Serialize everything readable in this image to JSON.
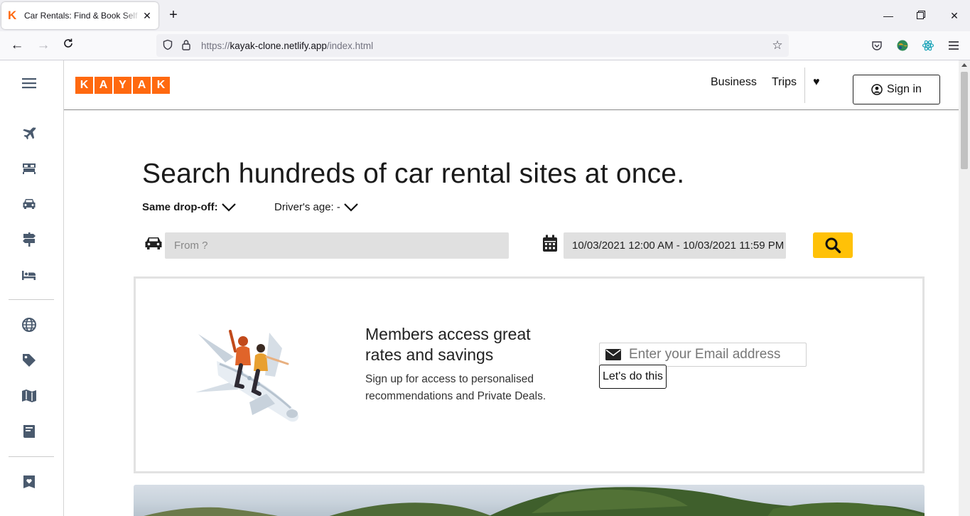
{
  "browser": {
    "tab": {
      "title": "Car Rentals: Find & Book Self Drive Car Rentals"
    },
    "url": {
      "scheme": "https://",
      "host": "kayak-clone.netlify.app",
      "path": "/index.html"
    }
  },
  "site": {
    "logo_letters": [
      "K",
      "A",
      "Y",
      "A",
      "K"
    ],
    "brand_color": "#ff690f",
    "nav": {
      "business": "Business",
      "trips": "Trips",
      "sign_in": "Sign in"
    }
  },
  "sidebar": {
    "items": [
      {
        "name": "flights",
        "icon": "plane-icon"
      },
      {
        "name": "stays",
        "icon": "bed-icon"
      },
      {
        "name": "cars",
        "icon": "car-icon"
      },
      {
        "name": "packages",
        "icon": "signpost-icon"
      },
      {
        "name": "hotels",
        "icon": "hotel-bed-icon"
      },
      {
        "name": "explore",
        "icon": "globe-icon"
      },
      {
        "name": "deals",
        "icon": "tag-icon"
      },
      {
        "name": "guides",
        "icon": "map-icon"
      },
      {
        "name": "blog",
        "icon": "book-icon"
      },
      {
        "name": "saved",
        "icon": "heart-card-icon"
      }
    ]
  },
  "search": {
    "headline": "Search hundreds of car rental sites at once.",
    "same_dropoff": "Same drop-off:",
    "drivers_age": "Driver's age: -",
    "from_placeholder": "From ?",
    "dates_value": "10/03/2021 12:00 AM - 10/03/2021 11:59 PM",
    "button_color": "#ffc107"
  },
  "promo": {
    "title": "Members access great rates and savings",
    "text": "Sign up for access to personalised recommendations and Private Deals.",
    "email_placeholder": "Enter your Email address",
    "cta": "Let's do this"
  }
}
